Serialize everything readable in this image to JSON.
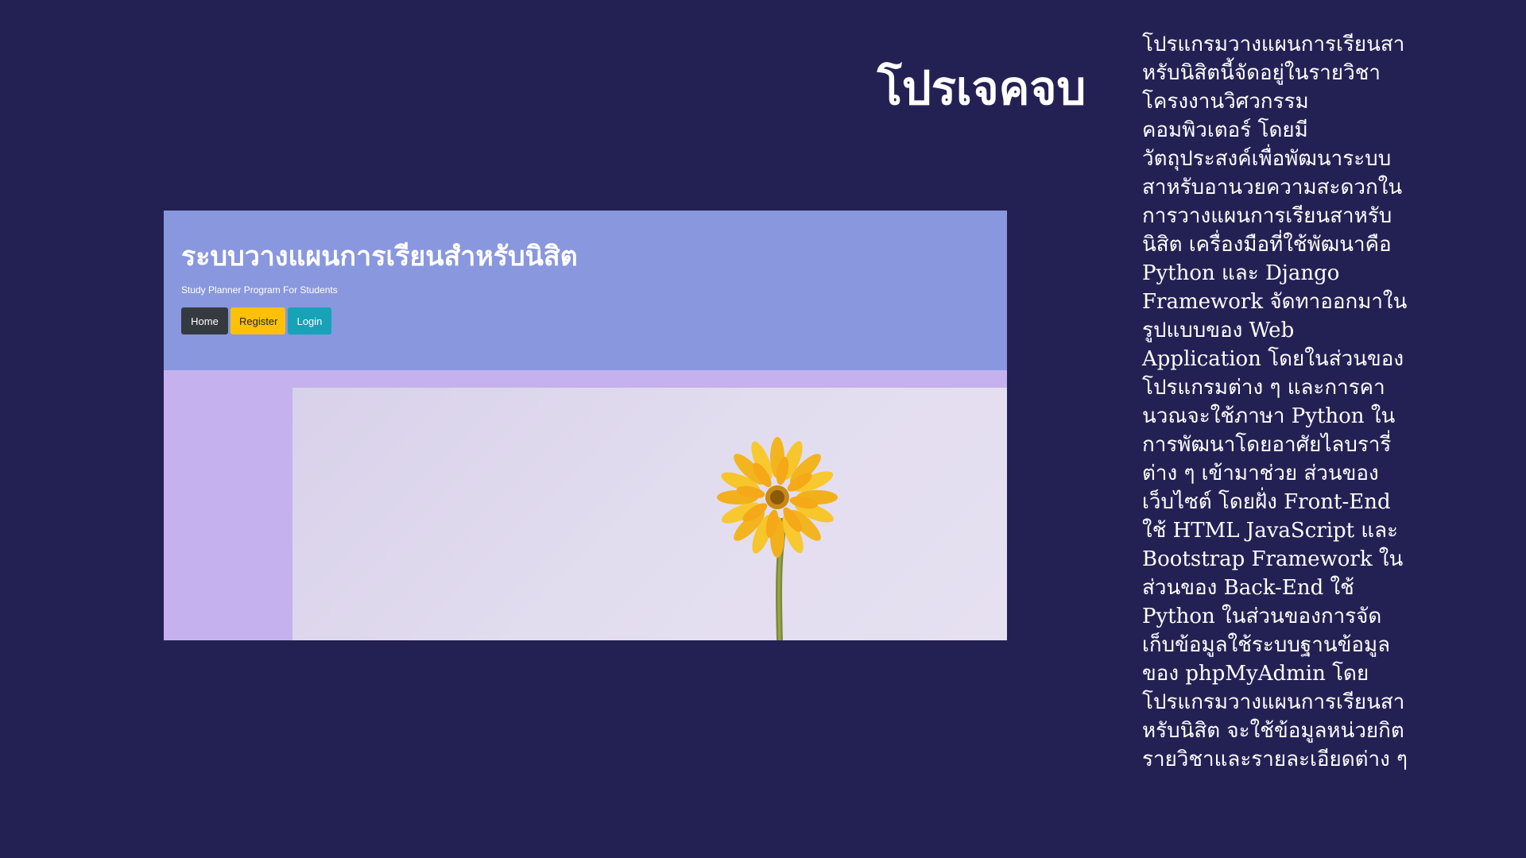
{
  "slide": {
    "title": "โปรเจคจบ",
    "description_lines": [
      "โปรแกรมวางแผนการเรียนสา",
      "หรับนิสิตนี้จัดอยู่ในรายวิชา",
      "โครงงานวิศวกรรม",
      "คอมพิวเตอร์ โดยมี",
      "วัตถุประสงค์เพื่อพัฒนาระบบ",
      "สาหรับอานวยความสะดวกใน",
      "การวางแผนการเรียนสาหรับ",
      "นิสิต เครื่องมือที่ใช้พัฒนาคือ",
      "Python และ Django",
      "Framework จัดทาออกมาใน",
      "รูปแบบของ Web",
      "Application โดยในส่วนของ",
      "โปรแกรมต่าง ๆ และการคา",
      "นวณจะใช้ภาษา Python ใน",
      "การพัฒนาโดยอาศัยไลบรารี่",
      "ต่าง ๆ เข้ามาช่วย ส่วนของ",
      "เว็บไซต์ โดยฝั่ง Front-End",
      "ใช้ HTML JavaScript และ",
      "Bootstrap Framework ใน",
      "ส่วนของ Back-End ใช้",
      "Python ในส่วนของการจัด",
      "เก็บข้อมูลใช้ระบบฐานข้อมูล",
      "ของ phpMyAdmin โดย",
      "โปรแกรมวางแผนการเรียนสา",
      "หรับนิสิต จะใช้ข้อมูลหน่วยกิต",
      "รายวิชาและรายละเอียดต่าง ๆ"
    ]
  },
  "app_screenshot": {
    "site_title": "ระบบวางแผนการเรียนสำหรับนิสิต",
    "site_subtitle": "Study Planner Program For Students",
    "nav": {
      "home_label": "Home",
      "register_label": "Register",
      "login_label": "Login"
    },
    "hero_image": "yellow-flower-photo"
  },
  "colors": {
    "background": "#232154",
    "header": "#8997de",
    "page_body": "#c4b1ee",
    "home_button": "#343a40",
    "register_button": "#ffc107",
    "login_button": "#17a2b8"
  }
}
